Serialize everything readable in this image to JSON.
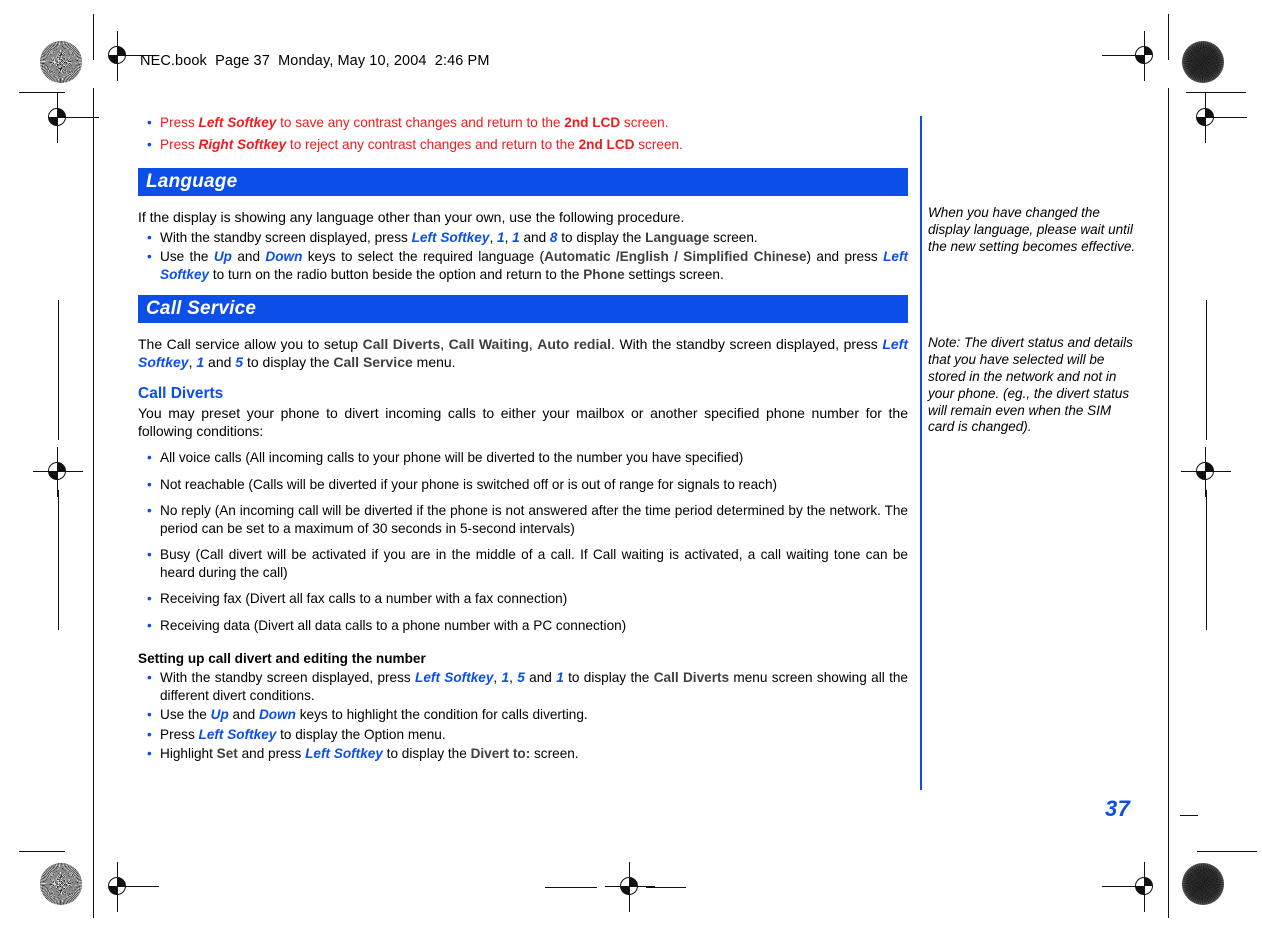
{
  "file_info": "NEC.book  Page 37  Monday, May 10, 2004  2:46 PM",
  "page_number": "37",
  "colors": {
    "accent_blue": "#0b4fe8",
    "alert_red": "#ee1c1c",
    "screen_gray": "#3f3f3f",
    "body_black": "#000000"
  },
  "bullet_glyph": "•",
  "red_notes": [
    {
      "pre": "Press ",
      "key": "Left Softkey",
      "mid": " to save any contrast changes and return to the ",
      "screen": "2nd LCD",
      "post": " screen."
    },
    {
      "pre": "Press ",
      "key": "Right Softkey",
      "mid": " to reject any contrast changes and return to the ",
      "screen": "2nd LCD",
      "post": " screen."
    }
  ],
  "sections": [
    {
      "heading": "Language",
      "intro": "If the display is showing any language other than your own, use the following procedure.",
      "bullets": [
        [
          {
            "t": "text",
            "v": "With the standby screen displayed, press "
          },
          {
            "t": "key",
            "v": "Left Softkey"
          },
          {
            "t": "text",
            "v": ", "
          },
          {
            "t": "key",
            "v": "1"
          },
          {
            "t": "text",
            "v": ", "
          },
          {
            "t": "key",
            "v": "1"
          },
          {
            "t": "text",
            "v": " and "
          },
          {
            "t": "key",
            "v": "8"
          },
          {
            "t": "text",
            "v": " to display the "
          },
          {
            "t": "screen",
            "v": "Language"
          },
          {
            "t": "text",
            "v": " screen."
          }
        ],
        [
          {
            "t": "text",
            "v": "Use the "
          },
          {
            "t": "key",
            "v": "Up"
          },
          {
            "t": "text",
            "v": " and "
          },
          {
            "t": "key",
            "v": "Down"
          },
          {
            "t": "text",
            "v": " keys to select the required language ("
          },
          {
            "t": "screen",
            "v": "Automatic /English / Simplified Chinese"
          },
          {
            "t": "text",
            "v": ") and press "
          },
          {
            "t": "key",
            "v": "Left Softkey"
          },
          {
            "t": "text",
            "v": " to turn on the radio button beside the option and return to the "
          },
          {
            "t": "screen",
            "v": "Phone"
          },
          {
            "t": "text",
            "v": " settings screen."
          }
        ]
      ]
    },
    {
      "heading": "Call Service",
      "intro_rich": [
        {
          "t": "text",
          "v": "The Call service allow you to setup "
        },
        {
          "t": "screen",
          "v": "Call Diverts"
        },
        {
          "t": "text",
          "v": ", "
        },
        {
          "t": "screen",
          "v": "Call Waiting"
        },
        {
          "t": "text",
          "v": ", "
        },
        {
          "t": "screen",
          "v": "Auto redial"
        },
        {
          "t": "text",
          "v": ". With the standby screen displayed, press "
        },
        {
          "t": "key",
          "v": "Left Softkey"
        },
        {
          "t": "text",
          "v": ", "
        },
        {
          "t": "key",
          "v": "1"
        },
        {
          "t": "text",
          "v": " and "
        },
        {
          "t": "key",
          "v": "5"
        },
        {
          "t": "text",
          "v": " to display the "
        },
        {
          "t": "screen",
          "v": "Call Service"
        },
        {
          "t": "text",
          "v": " menu."
        }
      ]
    }
  ],
  "call_diverts": {
    "heading": "Call Diverts",
    "intro": "You may preset your phone to divert incoming calls to either your mailbox or another specified phone number for the following conditions:",
    "conditions": [
      "All voice calls (All incoming calls to your phone will be diverted to the number you have specified)",
      "Not reachable (Calls will be diverted if your phone is switched off or is out of range for signals to reach)",
      "No reply (An incoming call will be diverted if the phone is not answered after the time period determined by the network. The period can be set to a maximum of 30 seconds in 5-second intervals)",
      "Busy (Call divert will be activated if you are in the middle of a call. If Call waiting is activated, a call waiting tone can be heard during the call)",
      "Receiving fax (Divert all fax calls to a number with a fax connection)",
      "Receiving data (Divert all data calls to a phone number with a PC connection)"
    ]
  },
  "setting_up": {
    "heading": "Setting up call divert and editing the number",
    "steps": [
      [
        {
          "t": "text",
          "v": "With the standby screen displayed, press "
        },
        {
          "t": "key",
          "v": "Left Softkey"
        },
        {
          "t": "text",
          "v": ", "
        },
        {
          "t": "key",
          "v": "1"
        },
        {
          "t": "text",
          "v": ", "
        },
        {
          "t": "key",
          "v": "5"
        },
        {
          "t": "text",
          "v": " and "
        },
        {
          "t": "key",
          "v": "1"
        },
        {
          "t": "text",
          "v": " to display the "
        },
        {
          "t": "screen",
          "v": "Call Diverts"
        },
        {
          "t": "text",
          "v": " menu screen showing all the different divert conditions."
        }
      ],
      [
        {
          "t": "text",
          "v": "Use the "
        },
        {
          "t": "key",
          "v": "Up"
        },
        {
          "t": "text",
          "v": " and "
        },
        {
          "t": "key",
          "v": "Down"
        },
        {
          "t": "text",
          "v": " keys to highlight the condition for calls diverting."
        }
      ],
      [
        {
          "t": "text",
          "v": "Press "
        },
        {
          "t": "key",
          "v": "Left Softkey"
        },
        {
          "t": "text",
          "v": " to display the Option menu."
        }
      ],
      [
        {
          "t": "text",
          "v": "Highlight "
        },
        {
          "t": "screen",
          "v": "Set"
        },
        {
          "t": "text",
          "v": " and press "
        },
        {
          "t": "key",
          "v": "Left Softkey"
        },
        {
          "t": "text",
          "v": " to display the "
        },
        {
          "t": "screen",
          "v": "Divert to:"
        },
        {
          "t": "text",
          "v": " screen."
        }
      ]
    ]
  },
  "sidebar_notes": [
    "When you have changed the display language, please wait until the new setting becomes effective.",
    "Note: The divert status and details that you have selected will be stored in the network and not in your phone. (eg., the divert status will remain even when the SIM card is changed)."
  ]
}
